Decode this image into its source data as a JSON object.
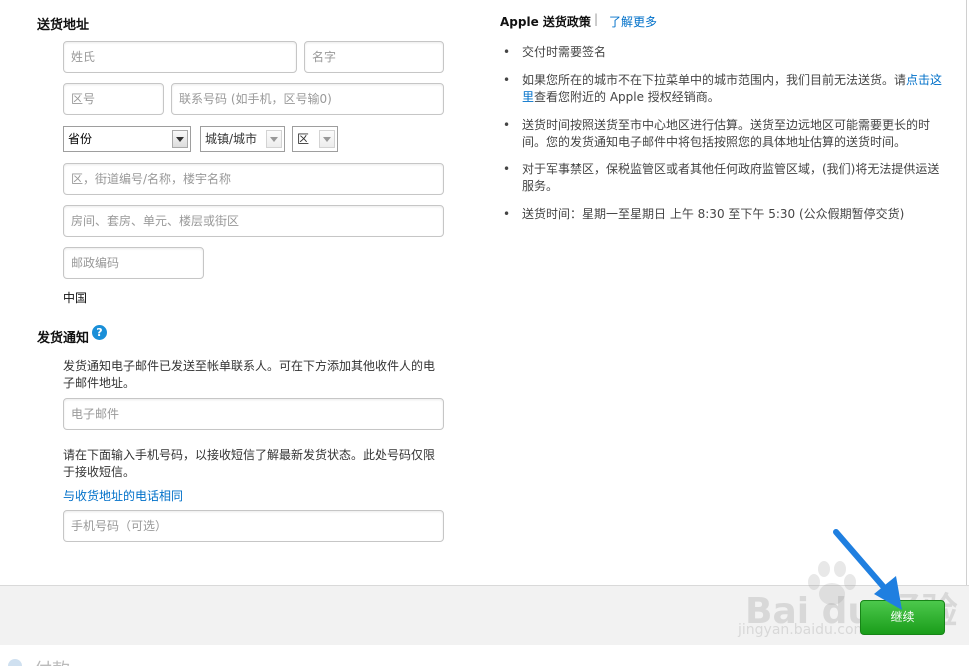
{
  "shipping_address": {
    "heading": "送货地址",
    "last_name_placeholder": "姓氏",
    "first_name_placeholder": "名字",
    "area_code_placeholder": "区号",
    "phone_placeholder": "联系号码 (如手机，区号输0)",
    "province_value": "省份",
    "city_value": "城镇/城市",
    "district_value": "区",
    "street_placeholder": "区，街道编号/名称，楼宇名称",
    "room_placeholder": "房间、套房、单元、楼层或街区",
    "postal_placeholder": "邮政编码",
    "country": "中国"
  },
  "notification": {
    "heading": "发货通知",
    "help_icon": "?",
    "description": "发货通知电子邮件已发送至帐单联系人。可在下方添加其他收件人的电子邮件地址。",
    "email_placeholder": "电子邮件",
    "sms_description": "请在下面输入手机号码，以接收短信了解最新发货状态。此处号码仅限于接收短信。",
    "same_phone_link": "与收货地址的电话相同",
    "mobile_placeholder": "手机号码（可选）"
  },
  "policy": {
    "title": "Apple 送货政策",
    "separator": "|",
    "learn_more": "了解更多",
    "bullet": "•",
    "items": [
      "交付时需要签名",
      "如果您所在的城市不在下拉菜单中的城市范围内，我们目前无法送货。请",
      "送货时间按照送货至市中心地区进行估算。送货至边远地区可能需要更长的时间。您的发货通知电子邮件中将包括按照您的具体地址估算的送货时间。",
      "对于军事禁区，保税监管区或者其他任何政府监管区域，(我们)将无法提供运送服务。",
      "送货时间：星期一至星期日 上午 8:30 至下午 5:30 (公众假期暂停交货)"
    ],
    "item2_link": "点击这里",
    "item2_tail": "查看您附近的 Apple 授权经销商。"
  },
  "footer": {
    "continue_button": "继续",
    "next_section": "付款"
  },
  "watermark": {
    "brand": "Bai du 经验",
    "url": "jingyan.baidu.com"
  },
  "colors": {
    "link": "#0070c9",
    "button": "#2fb22f",
    "arrow": "#1f7fe0"
  }
}
